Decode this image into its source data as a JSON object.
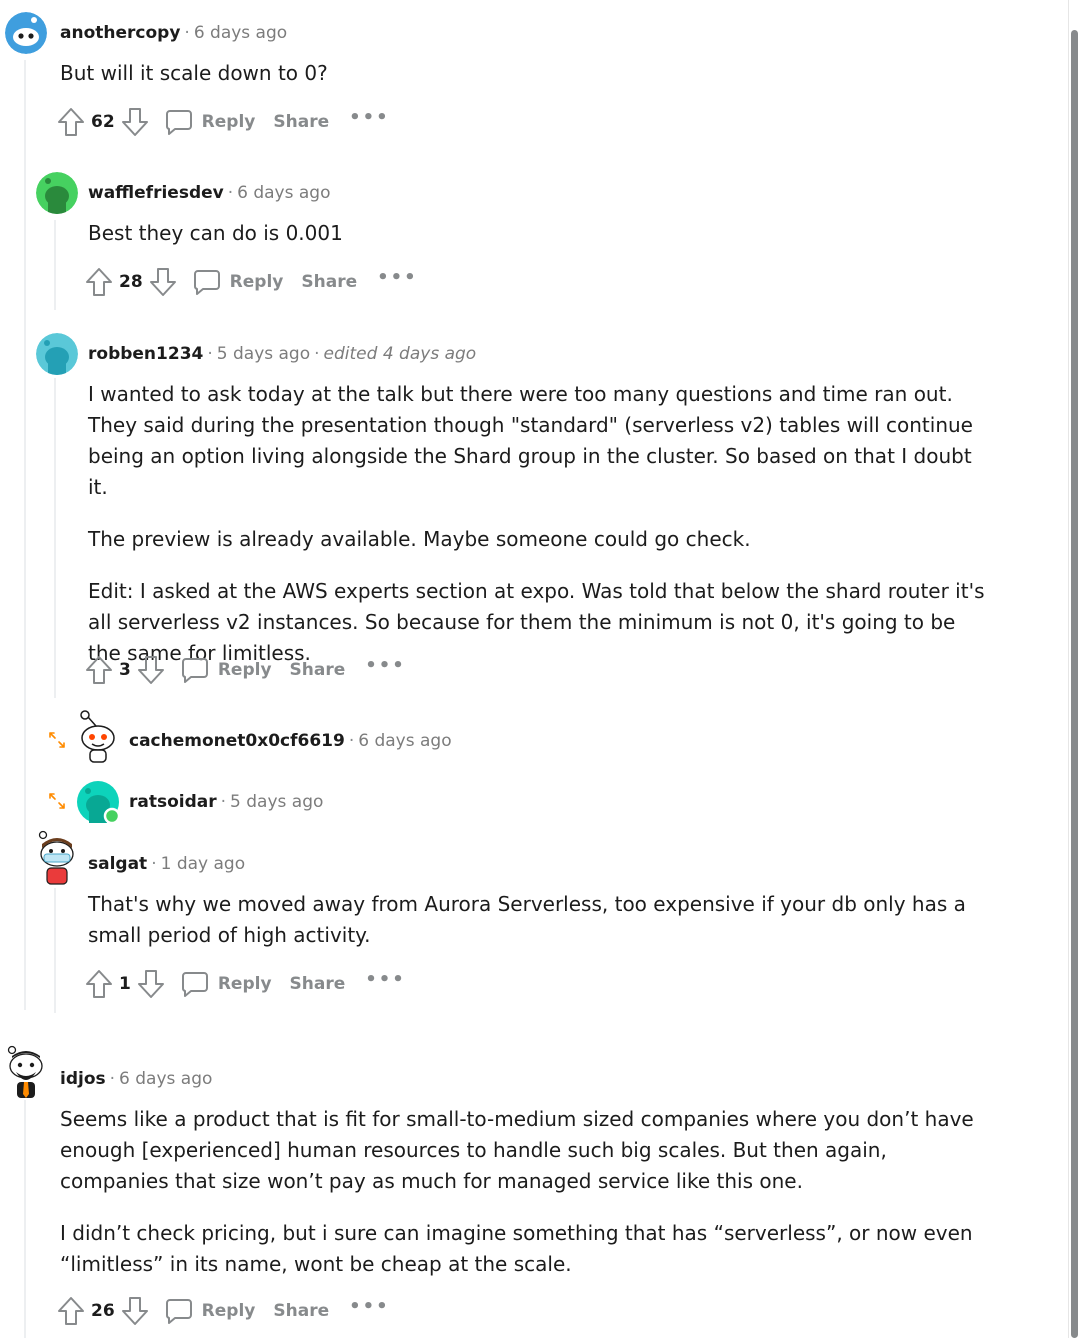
{
  "comments": [
    {
      "username": "anothercopy",
      "time": "6 days ago",
      "body": [
        "But will it scale down to 0?"
      ],
      "score": "62",
      "reply_label": "Reply",
      "share_label": "Share",
      "more_label": "•••"
    },
    {
      "username": "wafflefriesdev",
      "time": "6 days ago",
      "body": [
        "Best they can do is 0.001"
      ],
      "score": "28",
      "reply_label": "Reply",
      "share_label": "Share",
      "more_label": "•••"
    },
    {
      "username": "robben1234",
      "time": "5 days ago",
      "edited": "edited 4 days ago",
      "body": [
        "I wanted to ask today at the talk but there were too many questions and time ran out. They said during the presentation though \"standard\" (serverless v2) tables will continue being an option living alongside the Shard group in the cluster. So based on that I doubt it.",
        "The preview is already available. Maybe someone could go check.",
        "Edit: I asked at the AWS experts section at expo. Was told that below the shard router it's all serverless v2 instances. So because for them the minimum is not 0, it's going to be the same for limitless."
      ],
      "score": "3",
      "reply_label": "Reply",
      "share_label": "Share",
      "more_label": "•••"
    },
    {
      "username": "cachemonet0x0cf6619",
      "time": "6 days ago",
      "collapsed": true
    },
    {
      "username": "ratsoidar",
      "time": "5 days ago",
      "collapsed": true
    },
    {
      "username": "salgat",
      "time": "1 day ago",
      "body": [
        "That's why we moved away from Aurora Serverless, too expensive if your db only has a small period of high activity."
      ],
      "score": "1",
      "reply_label": "Reply",
      "share_label": "Share",
      "more_label": "•••"
    },
    {
      "username": "idjos",
      "time": "6 days ago",
      "body": [
        "Seems like a product that is fit for small-to-medium sized companies where you don’t have enough [experienced] human resources to handle such big scales. But then again, companies that size won’t pay as much for managed service like this one.",
        "I didn’t check pricing, but i sure can imagine something that has “serverless”, or now even “limitless” in its name, wont be cheap at the scale."
      ],
      "score": "26",
      "reply_label": "Reply",
      "share_label": "Share",
      "more_label": "•••"
    }
  ],
  "separator": "·",
  "colors": {
    "accent_blue": "#3f9ede",
    "avatar_green": "#46d160",
    "avatar_teal": "#24a0b5",
    "avatar_mint": "#0dd3bb",
    "expand_orange": "#ff8b00",
    "muted": "#878a8c"
  },
  "icons": {
    "upvote": "arrow-up-icon",
    "downvote": "arrow-down-icon",
    "reply": "speech-bubble-icon",
    "expand": "expand-arrows-icon"
  }
}
